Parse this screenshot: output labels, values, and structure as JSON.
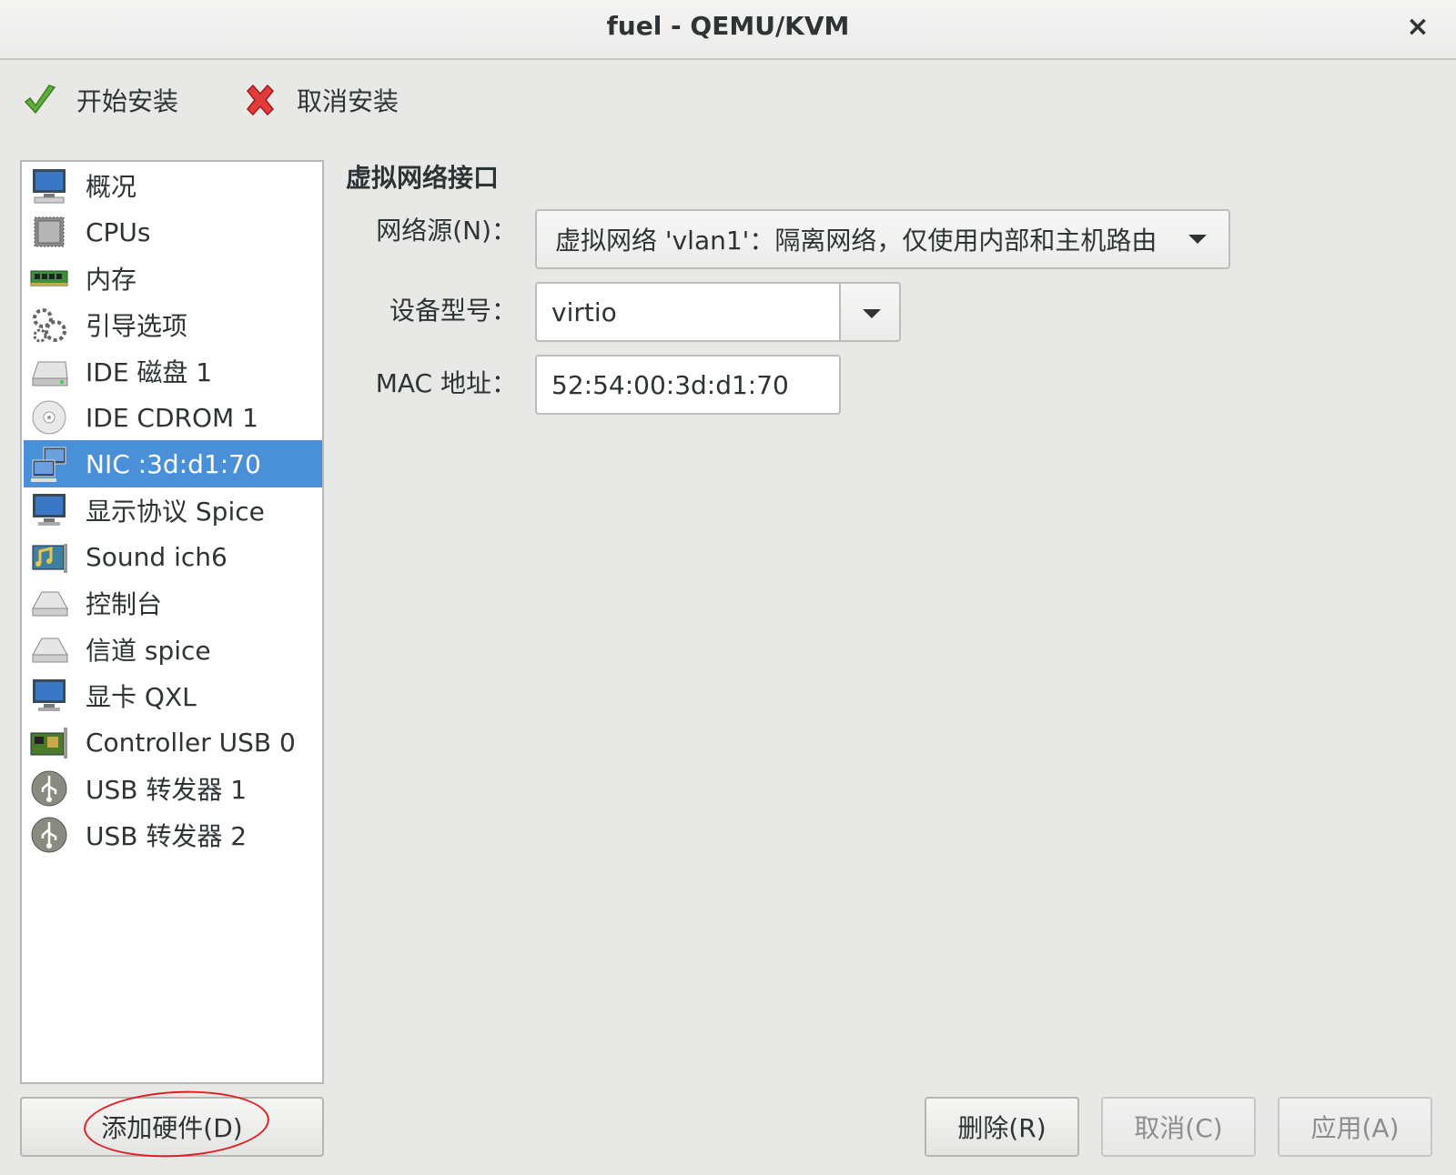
{
  "window": {
    "title": "fuel - QEMU/KVM",
    "close_glyph": "×"
  },
  "toolbar": {
    "install_label": "开始安装",
    "install_icon": "checkmark-icon",
    "cancel_label": "取消安装",
    "cancel_icon": "red-x-icon"
  },
  "sidebar": {
    "items": [
      {
        "label": "概况",
        "icon": "computer-monitor-icon"
      },
      {
        "label": "CPUs",
        "icon": "cpu-chip-icon"
      },
      {
        "label": "内存",
        "icon": "memory-stick-icon"
      },
      {
        "label": "引导选项",
        "icon": "gears-icon"
      },
      {
        "label": "IDE 磁盘 1",
        "icon": "hard-disk-icon"
      },
      {
        "label": "IDE CDROM 1",
        "icon": "cdrom-icon"
      },
      {
        "label": "NIC :3d:d1:70",
        "icon": "network-icon",
        "selected": true
      },
      {
        "label": "显示协议 Spice",
        "icon": "display-monitor-icon"
      },
      {
        "label": "Sound ich6",
        "icon": "sound-card-icon"
      },
      {
        "label": "控制台",
        "icon": "serial-console-icon"
      },
      {
        "label": "信道 spice",
        "icon": "channel-icon"
      },
      {
        "label": "显卡 QXL",
        "icon": "video-card-icon"
      },
      {
        "label": "Controller USB 0",
        "icon": "controller-card-icon"
      },
      {
        "label": "USB 转发器 1",
        "icon": "usb-icon"
      },
      {
        "label": "USB 转发器 2",
        "icon": "usb-icon"
      }
    ]
  },
  "details": {
    "section_title": "虚拟网络接口",
    "network_source_label": "网络源(N)：",
    "network_source_value": "虚拟网络 'vlan1'：隔离网络，仅使用内部和主机路由",
    "device_model_label": "设备型号：",
    "device_model_value": "virtio",
    "mac_label": "MAC 地址：",
    "mac_value": "52:54:00:3d:d1:70"
  },
  "buttons": {
    "add_hardware": "添加硬件(D)",
    "remove": "删除(R)",
    "cancel": "取消(C)",
    "apply": "应用(A)"
  },
  "colors": {
    "selection": "#4a90d9",
    "annotation": "#e02020"
  }
}
